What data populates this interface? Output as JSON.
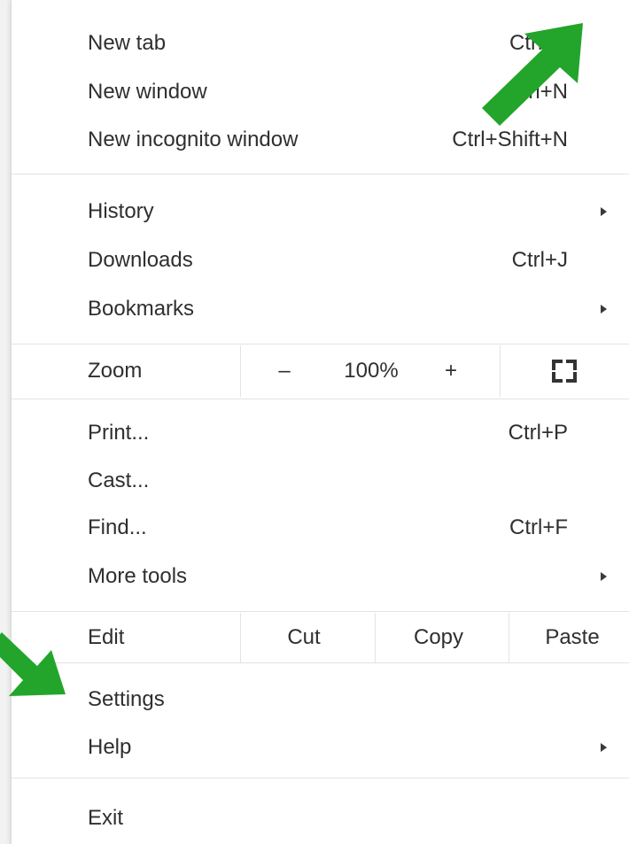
{
  "menu": {
    "new_tab": {
      "label": "New tab",
      "shortcut": "Ctrl+T"
    },
    "new_window": {
      "label": "New window",
      "shortcut": "Ctrl+N"
    },
    "new_incognito": {
      "label": "New incognito window",
      "shortcut": "Ctrl+Shift+N"
    },
    "history": {
      "label": "History"
    },
    "downloads": {
      "label": "Downloads",
      "shortcut": "Ctrl+J"
    },
    "bookmarks": {
      "label": "Bookmarks"
    },
    "zoom": {
      "label": "Zoom",
      "minus": "–",
      "value": "100%",
      "plus": "+"
    },
    "print": {
      "label": "Print...",
      "shortcut": "Ctrl+P"
    },
    "cast": {
      "label": "Cast..."
    },
    "find": {
      "label": "Find...",
      "shortcut": "Ctrl+F"
    },
    "more_tools": {
      "label": "More tools"
    },
    "edit": {
      "label": "Edit",
      "cut": "Cut",
      "copy": "Copy",
      "paste": "Paste"
    },
    "settings": {
      "label": "Settings"
    },
    "help": {
      "label": "Help"
    },
    "exit": {
      "label": "Exit"
    }
  },
  "annotations": {
    "arrow_color": "#22a52a",
    "icons": [
      "pointer-arrow-icon",
      "fullscreen-icon",
      "submenu-arrow-icon"
    ]
  }
}
